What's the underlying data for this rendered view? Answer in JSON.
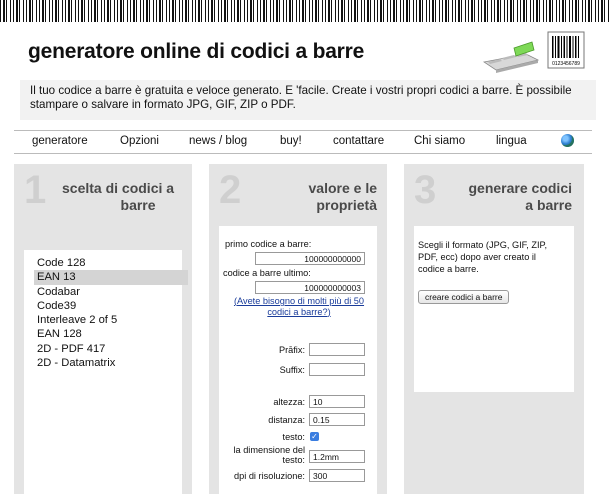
{
  "header": {
    "title": "generatore online di codici a barre",
    "logo_digits": "0123456789"
  },
  "intro": {
    "text": "Il tuo codice a barre è gratuita e veloce generato. E 'facile. Create i vostri propri codici a barre. È possibile stampare o salvare in formato JPG, GIF, ZIP o PDF."
  },
  "nav": {
    "items": [
      "generatore",
      "Opzioni",
      "news / blog",
      "buy!",
      "contattare",
      "Chi siamo",
      "lingua"
    ]
  },
  "panel1": {
    "num": "1",
    "title_line1": "scelta di codici a",
    "title_line2": "barre",
    "barcodes": [
      "Code 128",
      "EAN 13",
      "Codabar",
      "Code39",
      "Interleave 2 of 5",
      "EAN 128",
      "2D - PDF 417",
      "2D - Datamatrix"
    ],
    "selected": "EAN 13"
  },
  "panel2": {
    "num": "2",
    "title_line1": "valore e le",
    "title_line2": "proprietà",
    "first_label": "primo codice a barre:",
    "first_value": "100000000000",
    "last_label": "codice a barre ultimo:",
    "last_value": "100000000003",
    "link_line1": "Avete bisogno di molti più di 50",
    "link_line2": "codici a barre?",
    "link_open": "(",
    "link_close": ")",
    "prefix_label": "Prāfix:",
    "prefix_value": "",
    "suffix_label": "Suffix:",
    "suffix_value": "",
    "height_label": "altezza:",
    "height_value": "10",
    "distance_label": "distanza:",
    "distance_value": "0.15",
    "text_label": "testo:",
    "text_checked": true,
    "textsize_label_line1": "la dimensione del",
    "textsize_label_line2": "testo:",
    "textsize_value": "1.2mm",
    "dpi_label": "dpi di risoluzione:",
    "dpi_value": "300"
  },
  "panel3": {
    "num": "3",
    "title_line1": "generare codici",
    "title_line2": "a barre",
    "desc_line1": "Scegli il formato (JPG, GIF, ZIP,",
    "desc_line2": "PDF, ecc) dopo aver creato il",
    "desc_line3": "codice a barre.",
    "button": "creare codici a barre"
  }
}
